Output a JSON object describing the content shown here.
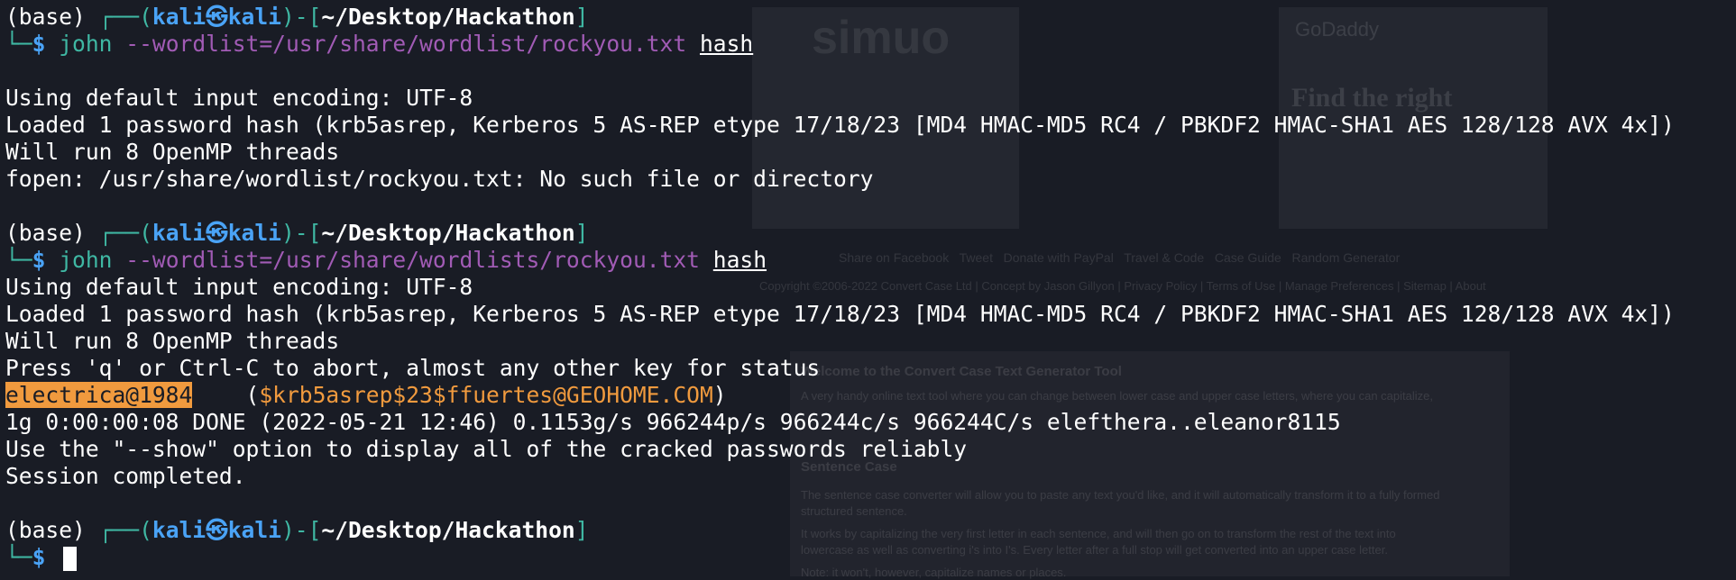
{
  "colors": {
    "background": "#191c25",
    "prompt_user_blue": "#4aa3f6",
    "prompt_frame_teal": "#3fb7a3",
    "option_purple": "#a15bb5",
    "highlight_orange": "#f09a3e"
  },
  "prompt": {
    "env": "(base) ",
    "frame_open": "┌──(",
    "user": "kali㉿kali",
    "frame_mid": ")-[",
    "path": "~/Desktop/Hackathon",
    "frame_close": "]",
    "corner": "└─",
    "dollar": "$ "
  },
  "cmd1": {
    "program": "john",
    "option": " --wordlist=/usr/share/wordlist/rockyou.txt ",
    "arg": "hash"
  },
  "out1": [
    "Using default input encoding: UTF-8",
    "Loaded 1 password hash (krb5asrep, Kerberos 5 AS-REP etype 17/18/23 [MD4 HMAC-MD5 RC4 / PBKDF2 HMAC-SHA1 AES 128/128 AVX 4x])",
    "Will run 8 OpenMP threads",
    "fopen: /usr/share/wordlist/rockyou.txt: No such file or directory"
  ],
  "cmd2": {
    "program": "john",
    "option": " --wordlist=/usr/share/wordlists/rockyou.txt ",
    "arg": "hash"
  },
  "out2": [
    "Using default input encoding: UTF-8",
    "Loaded 1 password hash (krb5asrep, Kerberos 5 AS-REP etype 17/18/23 [MD4 HMAC-MD5 RC4 / PBKDF2 HMAC-SHA1 AES 128/128 AVX 4x])",
    "Will run 8 OpenMP threads",
    "Press 'q' or Ctrl-C to abort, almost any other key for status"
  ],
  "cracked": {
    "password": "electrica@1984",
    "gap": "    (",
    "principal": "$krb5asrep$23$ffuertes@GEOHOME.COM",
    "close": ")"
  },
  "out3": [
    "1g 0:00:00:08 DONE (2022-05-21 12:46) 0.1153g/s 966244p/s 966244c/s 966244C/s elefthera..eleanor8115",
    "Use the \"--show\" option to display all of the cracked passwords reliably",
    "Session completed."
  ],
  "ghost": {
    "logo_text": "simuo",
    "godaddy": "GoDaddy",
    "find_text": "Find the right",
    "buttons": "Share on Facebook   Tweet   Donate with PayPal   Travel & Code   Case Guide   Random Generator",
    "copyright": "Copyright ©2006-2022 Convert Case Ltd | Concept by Jason Gillyon | Privacy Policy | Terms of Use | Manage Preferences | Sitemap | About",
    "heading": "Welcome to the Convert Case Text Generator Tool",
    "para1": "A very handy online text tool where you can change between lower case and upper case letters, where you can capitalize,",
    "subheading": "Sentence Case",
    "para2": "The sentence case converter will allow you to paste any text you'd like, and it will automatically transform it to a fully formed",
    "para3": "structured sentence.",
    "para4": "It works by capitalizing the very first letter in each sentence, and will then go on to transform the rest of the text into",
    "para5": "lowercase as well as converting i's into I's. Every letter after a full stop will get converted into an upper case letter.",
    "para6": "Note: it won't, however, capitalize names or places."
  }
}
